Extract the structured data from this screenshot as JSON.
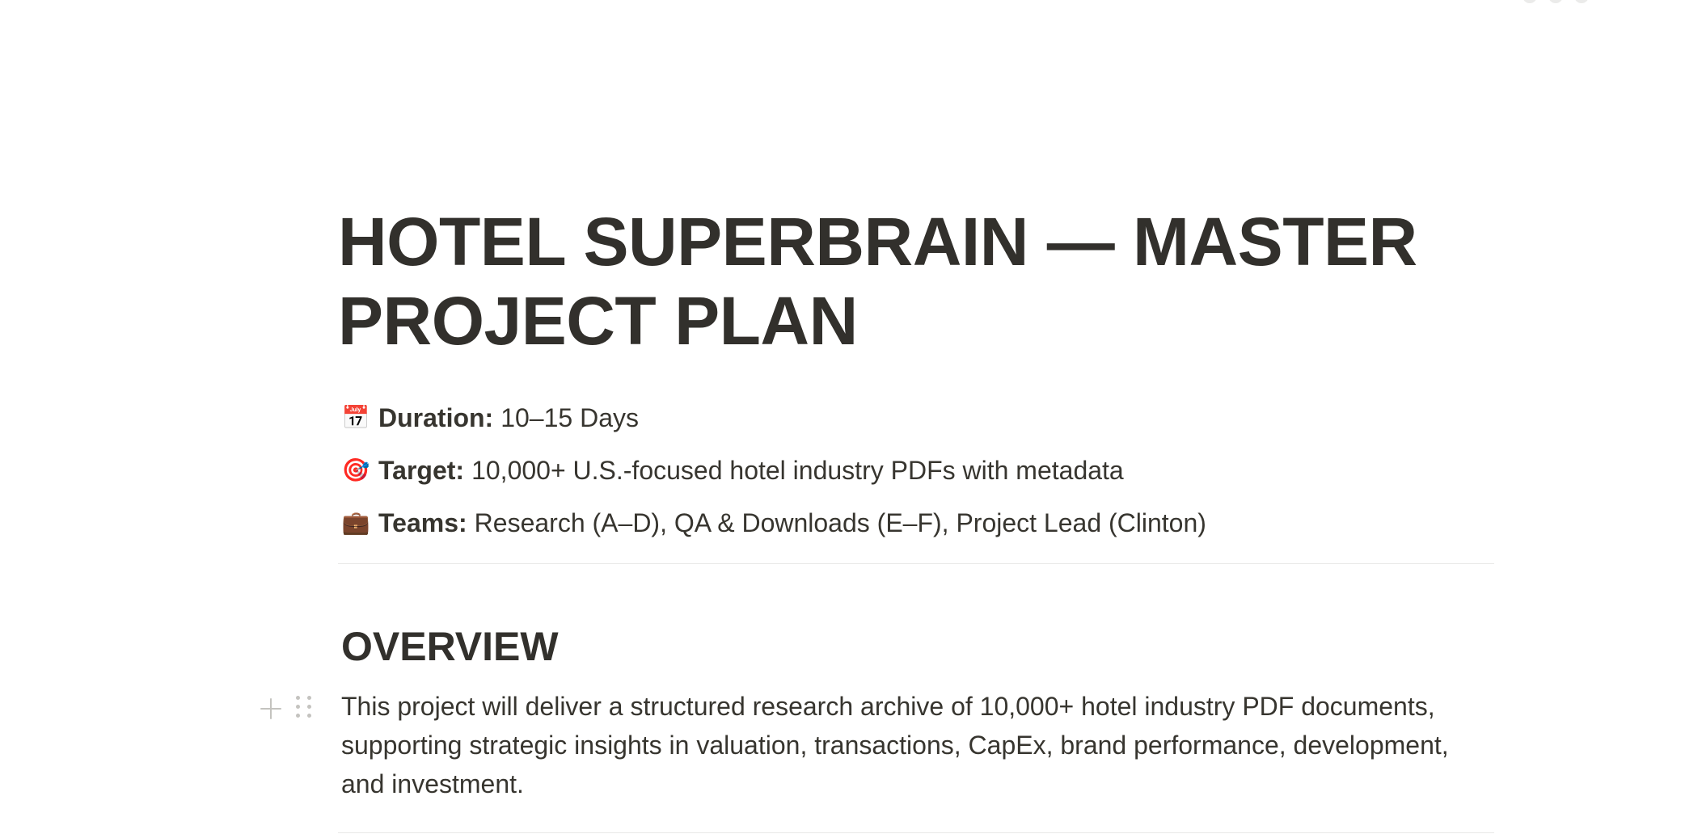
{
  "doc": {
    "title": "HOTEL SUPERBRAIN — MASTER PROJECT PLAN",
    "properties": [
      {
        "icon": "calendar-icon",
        "emoji": "📅",
        "label": "Duration:",
        "value": "10–15 Days"
      },
      {
        "icon": "target-icon",
        "emoji": "🎯",
        "label": "Target:",
        "value": "10,000+ U.S.-focused hotel industry PDFs with metadata"
      },
      {
        "icon": "briefcase-icon",
        "emoji": "💼",
        "label": "Teams:",
        "value": "Research (A–D), QA & Downloads (E–F), Project Lead (Clinton)"
      }
    ],
    "overview": {
      "heading": "OVERVIEW",
      "paragraph": "This project will deliver a structured research archive of 10,000+ hotel industry PDF documents, supporting strategic insights in valuation, transactions, CapEx, brand performance, development, and investment."
    }
  },
  "colors": {
    "text": "#37352f",
    "title": "#32302c",
    "divider": "#e9e9e7",
    "handle": "#c4c3bf"
  }
}
